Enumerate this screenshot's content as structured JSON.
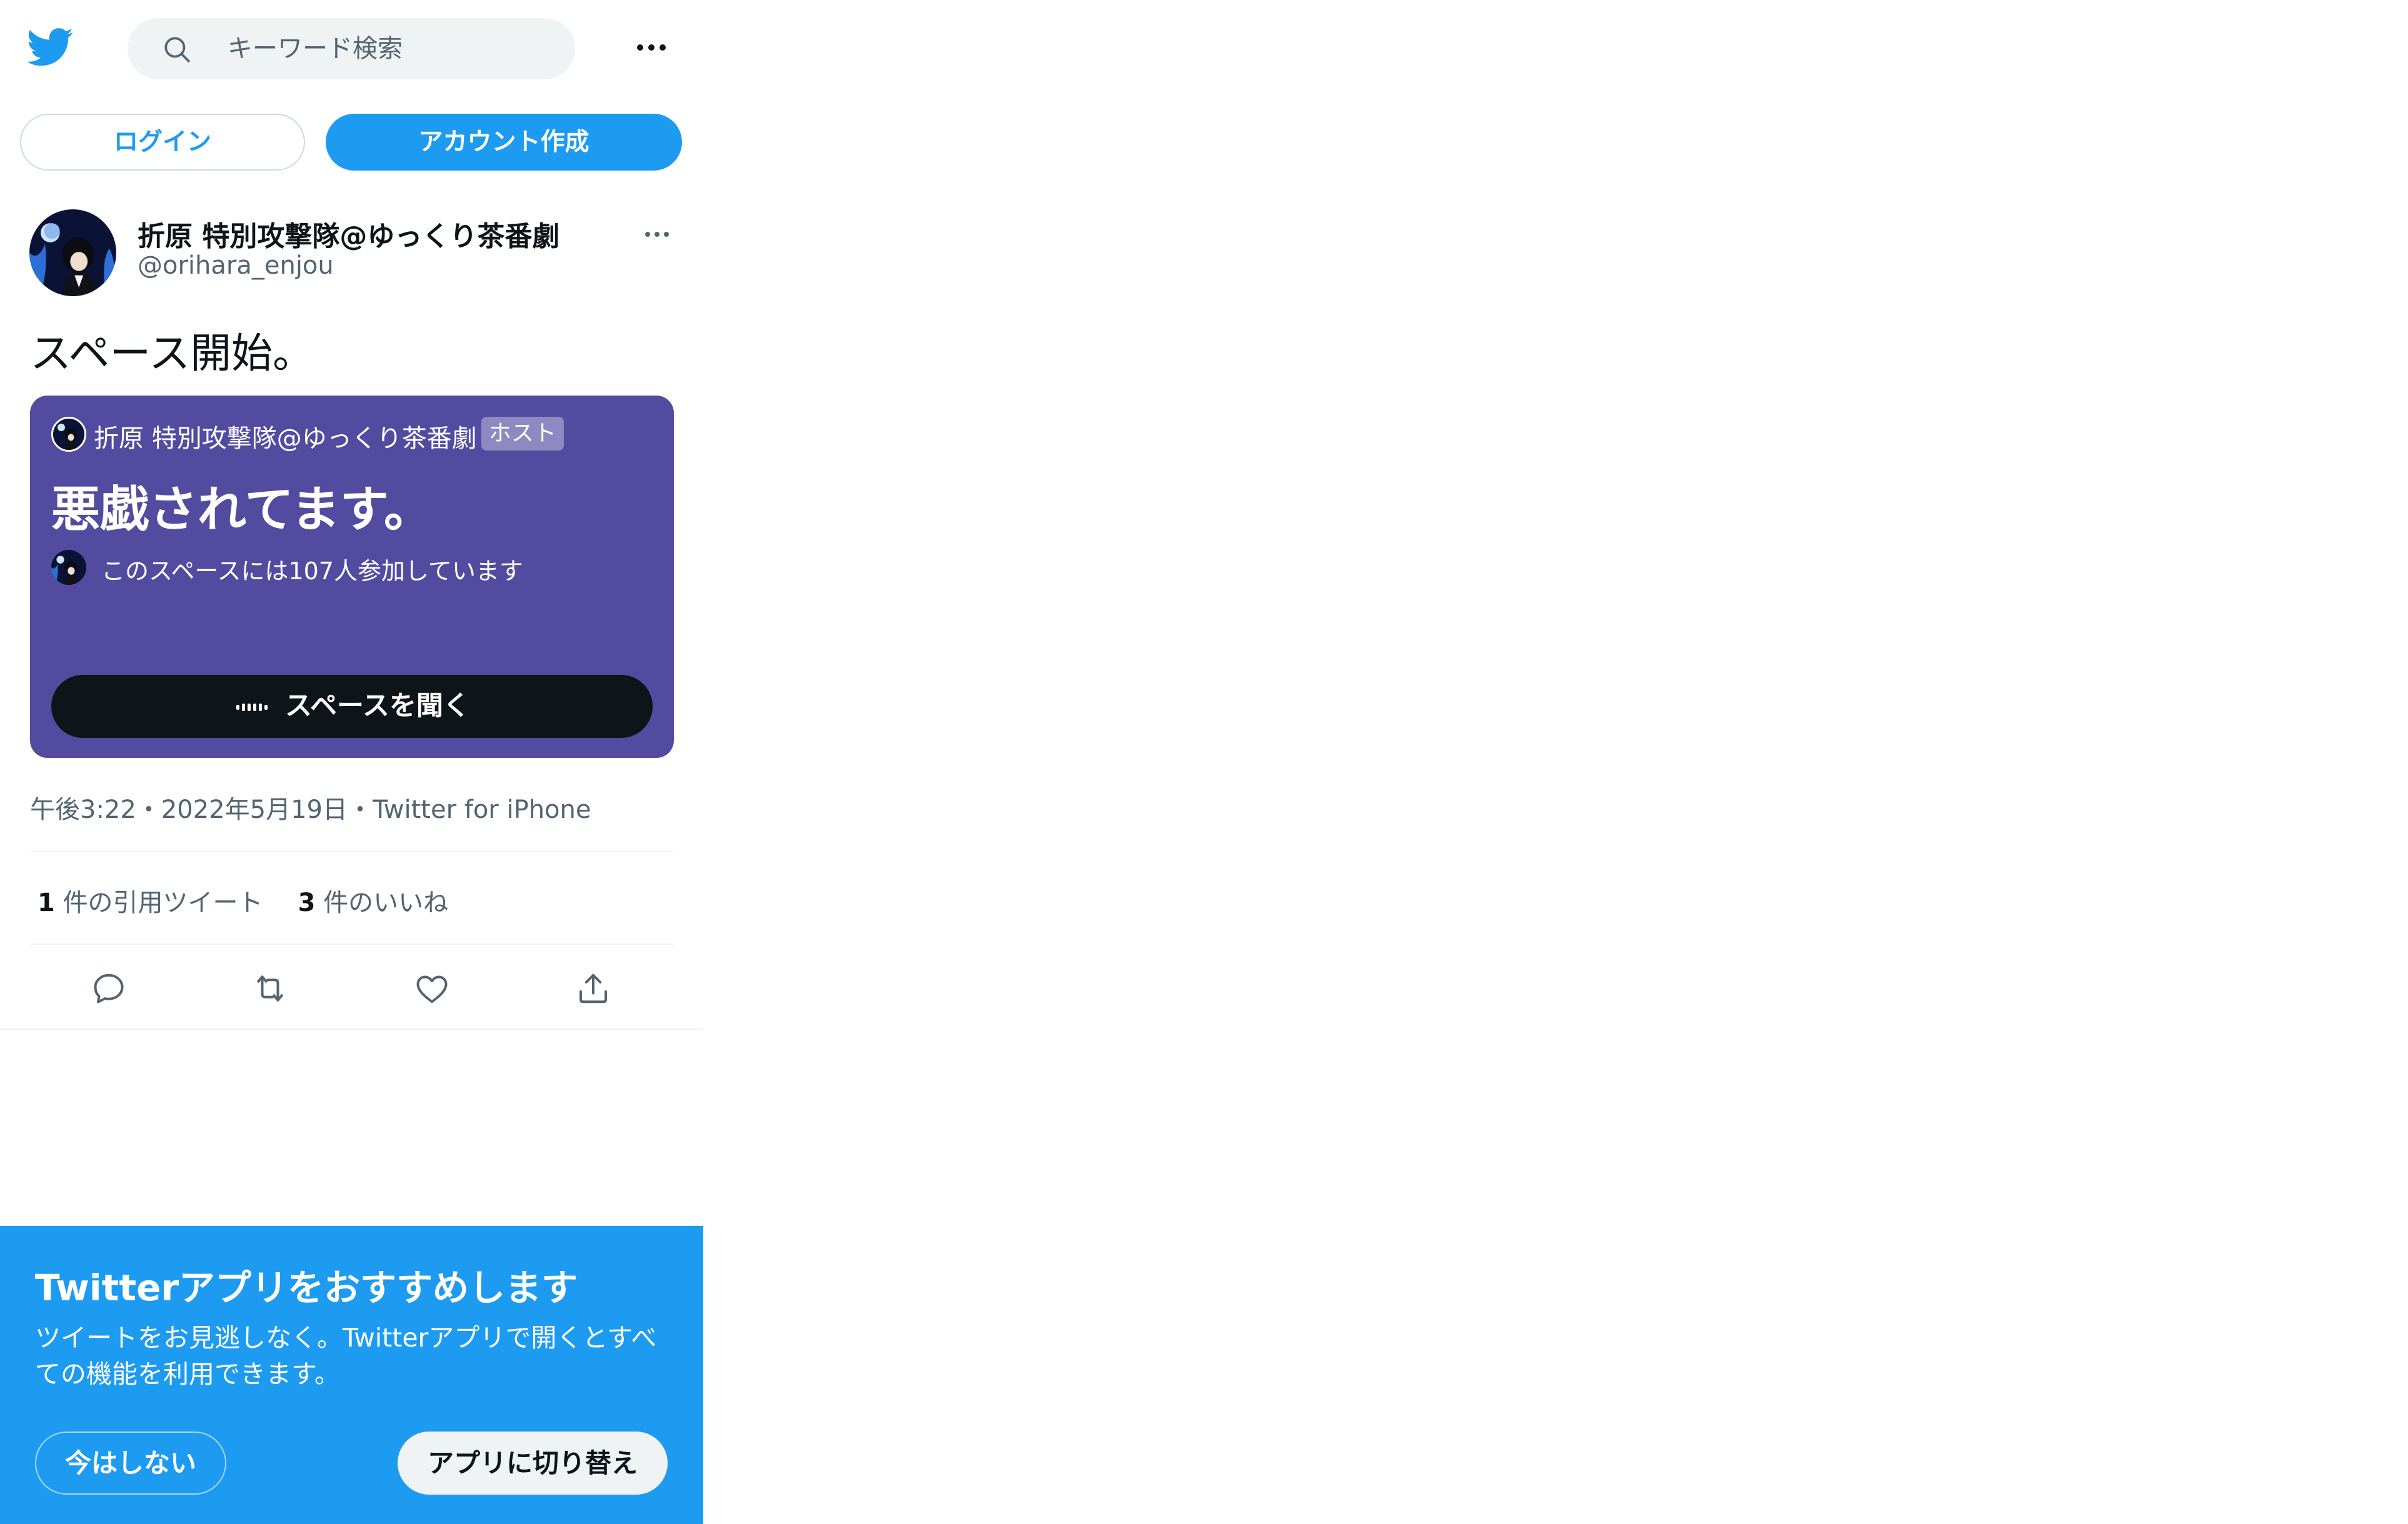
{
  "header": {
    "logo_icon": "twitter-bird-icon",
    "search": {
      "icon": "search-icon",
      "placeholder": "キーワード検索"
    },
    "more_icon": "more-horizontal-icon"
  },
  "auth": {
    "login_label": "ログイン",
    "signup_label": "アカウント作成"
  },
  "tweet": {
    "author_name": "折原 特別攻撃隊@ゆっくり茶番劇",
    "author_handle": "@orihara_enjou",
    "text": "スペース開始。",
    "meta": "午後3:22・2022年5月19日・Twitter for iPhone",
    "stats": {
      "quotes_count": "1",
      "quotes_label": "件の引用ツイート",
      "likes_count": "3",
      "likes_label": "件のいいね"
    },
    "actions": [
      "reply-icon",
      "retweet-icon",
      "like-icon",
      "share-icon"
    ]
  },
  "space_card": {
    "host_name": "折原 特別攻撃隊@ゆっくり茶番劇",
    "host_badge": "ホスト",
    "title": "悪戯されてます。",
    "participants_text": "このスペースには107人参加しています",
    "listen_label": "スペースを聞く",
    "background_color": "#524ba0"
  },
  "banner": {
    "title": "Twitterアプリをおすすめします",
    "description": "ツイートをお見逃しなく。Twitterアプリで開くとすべての機能を利用できます。",
    "not_now_label": "今はしない",
    "switch_label": "アプリに切り替え"
  },
  "colors": {
    "accent": "#1d9bf0",
    "text_primary": "#0f1419",
    "text_secondary": "#536471"
  }
}
